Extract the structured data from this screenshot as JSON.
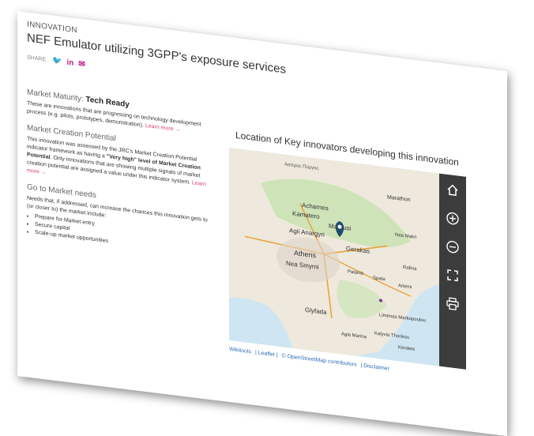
{
  "header": {
    "eyebrow": "INNOVATION",
    "title": "NEF Emulator utilizing 3GPP's exposure services",
    "share_label": "SHARE:"
  },
  "maturity": {
    "label": "Market Maturity:",
    "value": "Tech Ready",
    "text": "These are innovations that are progressing on technology development process (e.g. pilots, prototypes, demonstration).",
    "link": "Learn more →"
  },
  "creation": {
    "label": "Market Creation Potential",
    "text1": "This innovation was assessed by the JRC's Market Creation Potential indicator framework as having a",
    "strong": "\"Very high\" level of Market Creation Potential",
    "text2": ". Only innovations that are showing multiple signals of market creation potential are assigned a value under this indicator system.",
    "link": "Learn more →"
  },
  "needs": {
    "label": "Go to Market needs",
    "intro": "Needs that, if addressed, can increase the chances this innovation gets to (or closer to) the market include:",
    "items": [
      "Prepare for Market entry",
      "Secure capital",
      "Scale-up market opportunities"
    ]
  },
  "map": {
    "title": "Location of Key innovators developing this innovation",
    "places": [
      "Ασπρος Πύργος",
      "Marathon",
      "Acharnes",
      "Kamatero",
      "Marousi",
      "Nea Makri",
      "Agii Anargyri",
      "Gerakas",
      "Athens",
      "Rafina",
      "Nea Smyrni",
      "Paiania",
      "Spata",
      "Artemi",
      "Glyfada",
      "Limenas Markopoulou",
      "Agia Marina",
      "Kalyvia Thorikou",
      "Keratea"
    ],
    "attribution": [
      "Wikitools",
      "| Leaflet |",
      "© OpenStreetMap contributors",
      "| Disclaimer"
    ],
    "controls": [
      "home-icon",
      "zoom-in-icon",
      "zoom-out-icon",
      "fullscreen-icon",
      "print-icon"
    ]
  }
}
